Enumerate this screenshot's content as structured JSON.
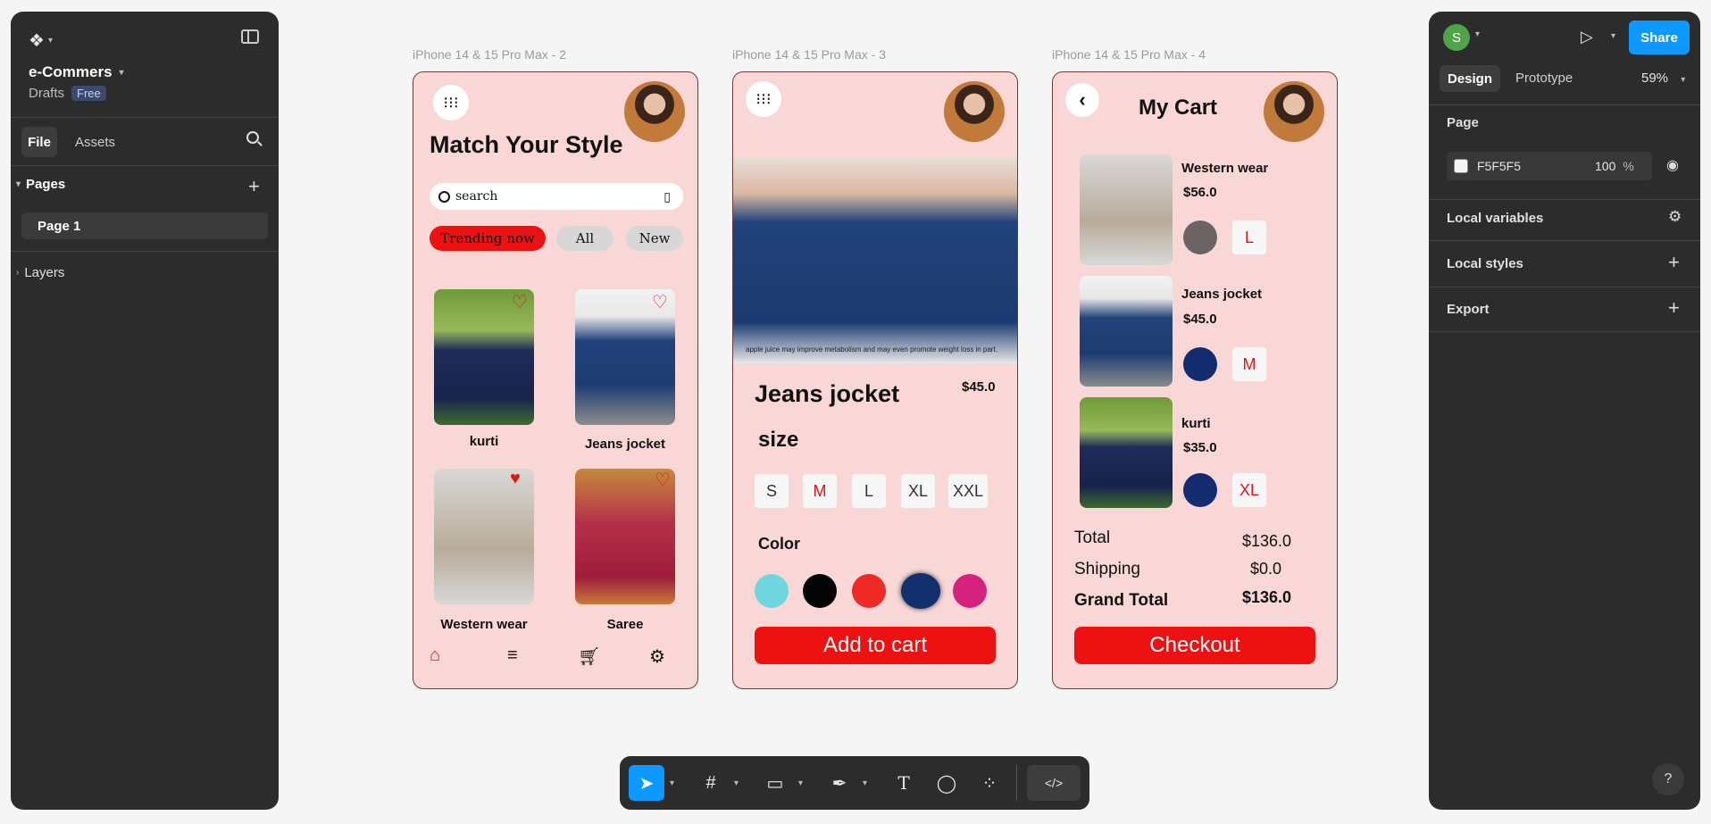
{
  "left_panel": {
    "project_name": "e-Commers",
    "location": "Drafts",
    "plan_badge": "Free",
    "tabs": {
      "file": "File",
      "assets": "Assets"
    },
    "pages_header": "Pages",
    "pages": [
      "Page 1"
    ],
    "layers_header": "Layers"
  },
  "right_panel": {
    "avatar_initial": "S",
    "share_label": "Share",
    "tabs": {
      "design": "Design",
      "prototype": "Prototype"
    },
    "zoom": "59%",
    "page_section": "Page",
    "page_color": "F5F5F5",
    "page_opacity": "100",
    "percent_sign": "%",
    "local_variables": "Local variables",
    "local_styles": "Local styles",
    "export": "Export",
    "help": "?"
  },
  "frames": {
    "f2_label": "iPhone 14 & 15 Pro Max - 2",
    "f3_label": "iPhone 14 & 15 Pro Max - 3",
    "f4_label": "iPhone 14 & 15 Pro Max - 4"
  },
  "home": {
    "title": "Match Your Style",
    "search_placeholder": "search",
    "tabs": [
      "Trending now",
      "All",
      "New"
    ],
    "products": [
      "kurti",
      "Jeans jocket",
      "Western wear",
      "Saree"
    ]
  },
  "detail": {
    "caption": "apple juice may improve metabolism and may even promote weight loss in part.",
    "name": "Jeans jocket",
    "price": "$45.0",
    "size_label": "size",
    "sizes": [
      "S",
      "M",
      "L",
      "XL",
      "XXL"
    ],
    "color_label": "Color",
    "colors": [
      "#6fd6dd",
      "#050505",
      "#ef2a24",
      "#13306e",
      "#d4227e"
    ],
    "button": "Add to cart"
  },
  "cart": {
    "title": "My Cart",
    "items": [
      {
        "name": "Western wear",
        "price": "$56.0",
        "color": "#6b6464",
        "size": "L"
      },
      {
        "name": "Jeans jocket",
        "price": "$45.0",
        "color": "#152b70",
        "size": "M"
      },
      {
        "name": "kurti",
        "price": "$35.0",
        "color": "#152b70",
        "size": "XL"
      }
    ],
    "total_label": "Total",
    "total_value": "$136.0",
    "shipping_label": "Shipping",
    "shipping_value": "$0.0",
    "grand_label": "Grand Total",
    "grand_value": "$136.0",
    "button": "Checkout"
  },
  "colors": {
    "accent_red": "#ee1111",
    "figma_blue": "#0d99ff",
    "frame_bg": "#f8d7d6",
    "panel_bg": "#2c2c2c"
  }
}
